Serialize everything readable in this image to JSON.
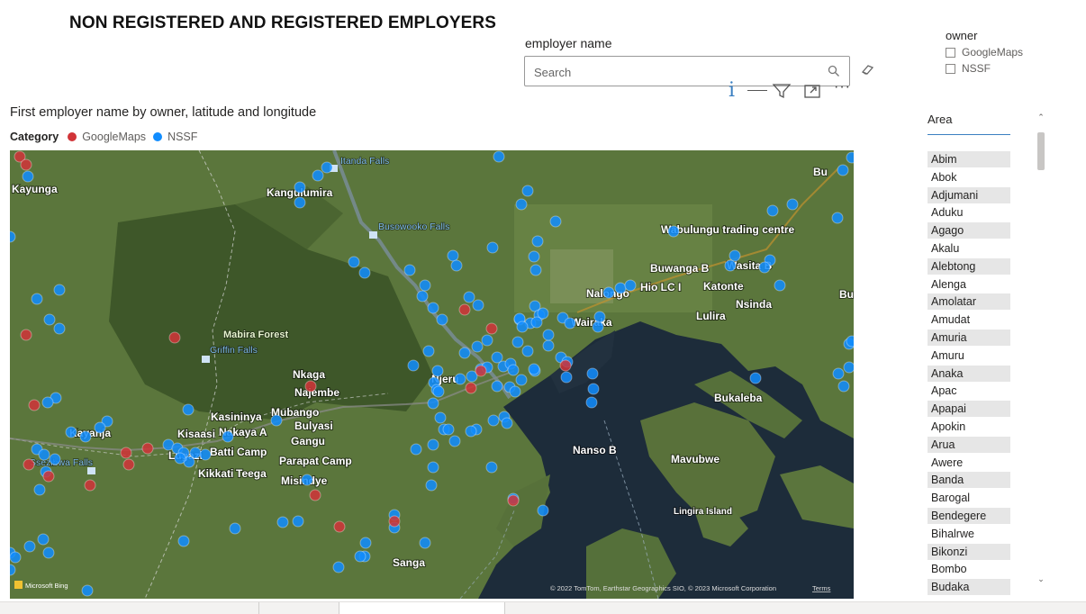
{
  "page": {
    "title": "NON REGISTERED AND REGISTERED EMPLOYERS"
  },
  "employer_slicer": {
    "label": "employer name",
    "placeholder": "Search"
  },
  "owner_slicer": {
    "label": "owner",
    "options": [
      "GoogleMaps",
      "NSSF"
    ]
  },
  "visual": {
    "title": "First employer name by owner, latitude and longitude",
    "legend_label": "Category",
    "legend": [
      {
        "name": "GoogleMaps",
        "color": "#d13438"
      },
      {
        "name": "NSSF",
        "color": "#118dff"
      }
    ],
    "header_icons": [
      "info-icon",
      "filter-icon",
      "focus-mode-icon",
      "more-options-icon"
    ]
  },
  "map": {
    "attribution": "© 2022 TomTom, Earthstar Geographics SIO, © 2023 Microsoft Corporation",
    "terms": "Terms",
    "bing": "Microsoft Bing",
    "places": [
      "Kayunga",
      "Kangulumira",
      "Nkaga",
      "Najembe",
      "Njeru",
      "Kasininya",
      "Mubango",
      "Bulyasi",
      "Gangu",
      "Kayanja",
      "Kisaasi",
      "Nakaya A",
      "Batti Camp",
      "Lugazi",
      "Kikkati",
      "Teega",
      "Parapat Camp",
      "Misindye",
      "Sanga",
      "Wabulungu trading centre",
      "Buwanga B",
      "Nalongo",
      "Hio LC I",
      "Katonte",
      "Wasita B",
      "Nsinda",
      "Wairaka",
      "Lulira",
      "Bukaleba",
      "Nanso B",
      "Mavubwe",
      "Lingira Island",
      "Bu",
      "Bu"
    ],
    "water_features": [
      "Itanda Falls",
      "Busowooko Falls",
      "Griffin Falls",
      "Ssezibwa Falls"
    ],
    "parks": [
      "Mabira Forest"
    ]
  },
  "area_slicer": {
    "header": "Area",
    "items": [
      "Abim",
      "Abok",
      "Adjumani",
      "Aduku",
      "Agago",
      "Akalu",
      "Alebtong",
      "Alenga",
      "Amolatar",
      "Amudat",
      "Amuria",
      "Amuru",
      "Anaka",
      "Apac",
      "Apapai",
      "Apokin",
      "Arua",
      "Awere",
      "Banda",
      "Barogal",
      "Bendegere",
      "Bihalrwe",
      "Bikonzi",
      "Bombo",
      "Budaka"
    ]
  }
}
